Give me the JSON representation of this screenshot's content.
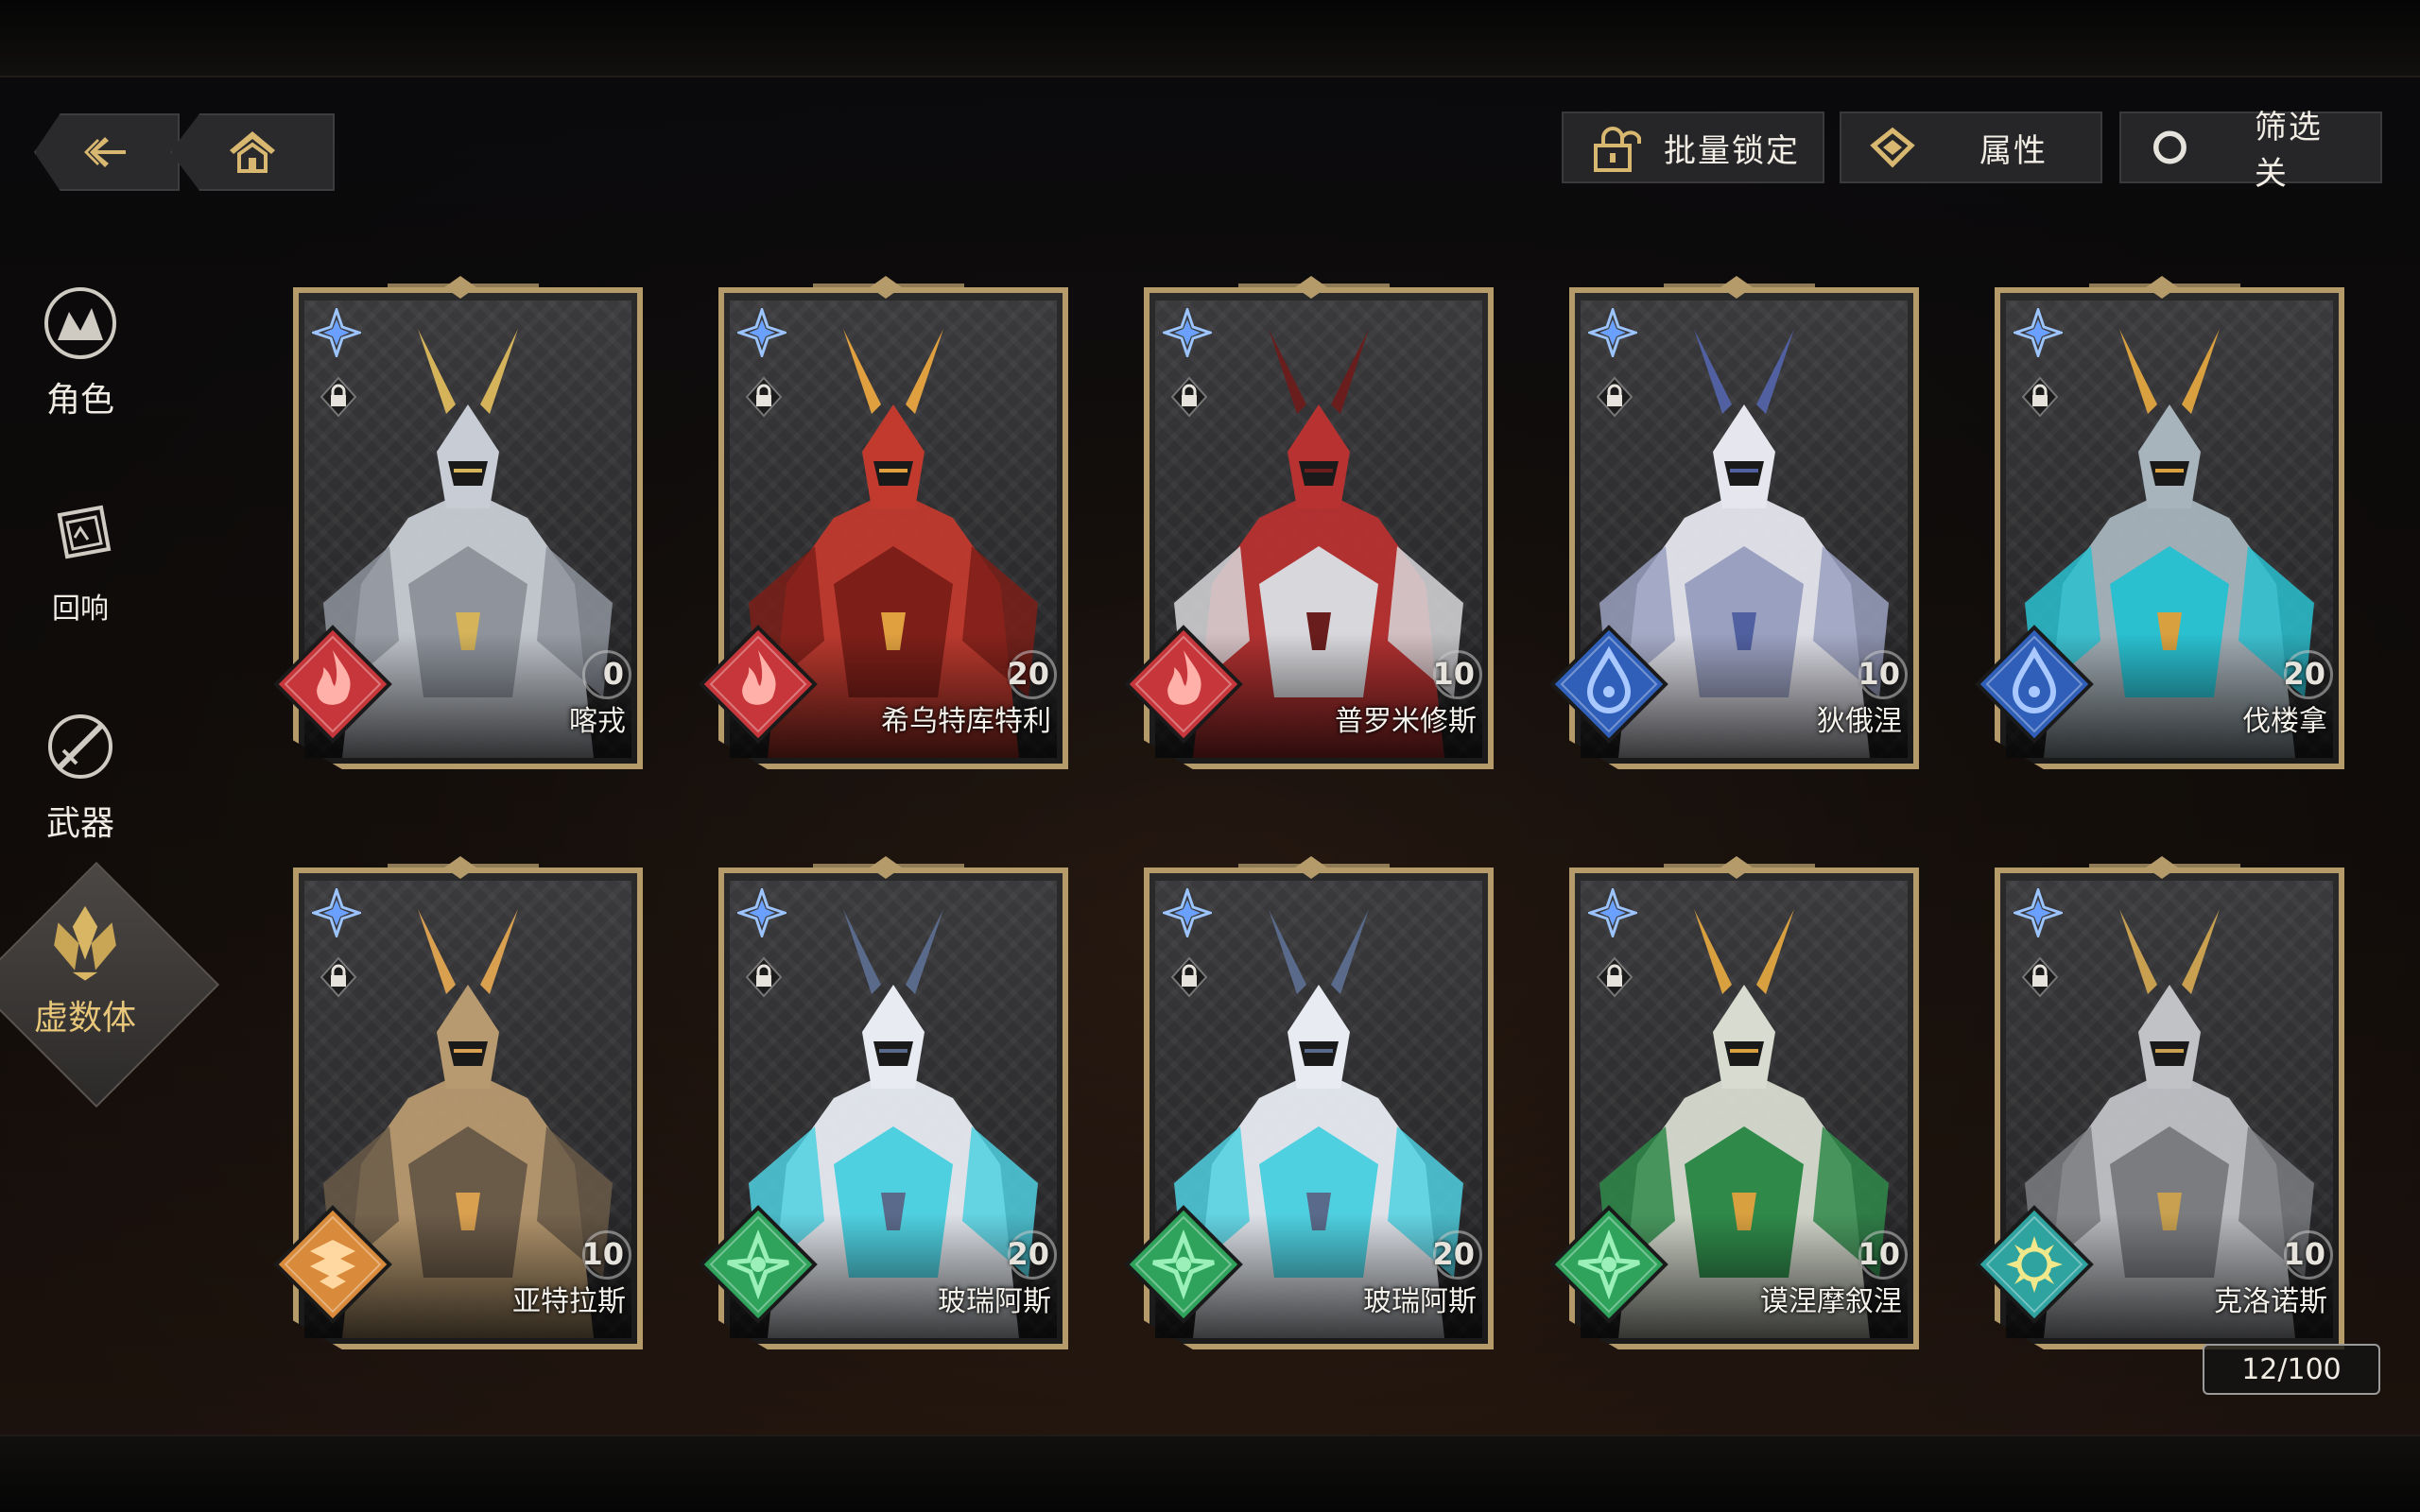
{
  "nav": {
    "back_icon": "back-arrow-icon",
    "home_icon": "home-icon"
  },
  "toolbar": {
    "batch_lock_label": "批量锁定",
    "attribute_label": "属性",
    "filter_label": "筛选 关"
  },
  "sidebar": {
    "items": [
      {
        "label": "角色",
        "icon": "character-icon",
        "active": false
      },
      {
        "label": "回响",
        "icon": "echo-icon",
        "active": false
      },
      {
        "label": "武器",
        "icon": "weapon-icon",
        "active": false
      },
      {
        "label": "虚数体",
        "icon": "imaginary-icon",
        "active": true
      }
    ]
  },
  "colors": {
    "fire": "#c7363a",
    "water": "#2f5fb8",
    "earth": "#d98a3a",
    "wind": "#2fa35b",
    "light": "#2fa3a0",
    "gold": "#b59a6a"
  },
  "cards": [
    {
      "name": "喀戎",
      "level": "0",
      "element": "fire"
    },
    {
      "name": "希乌特库特利",
      "level": "20",
      "element": "fire"
    },
    {
      "name": "普罗米修斯",
      "level": "10",
      "element": "fire"
    },
    {
      "name": "狄俄涅",
      "level": "10",
      "element": "water"
    },
    {
      "name": "伐楼拿",
      "level": "20",
      "element": "water"
    },
    {
      "name": "亚特拉斯",
      "level": "10",
      "element": "earth"
    },
    {
      "name": "玻瑞阿斯",
      "level": "20",
      "element": "wind"
    },
    {
      "name": "玻瑞阿斯",
      "level": "20",
      "element": "wind"
    },
    {
      "name": "谟涅摩叙涅",
      "level": "10",
      "element": "wind"
    },
    {
      "name": "克洛诺斯",
      "level": "10",
      "element": "light"
    }
  ],
  "counter": "12/100"
}
